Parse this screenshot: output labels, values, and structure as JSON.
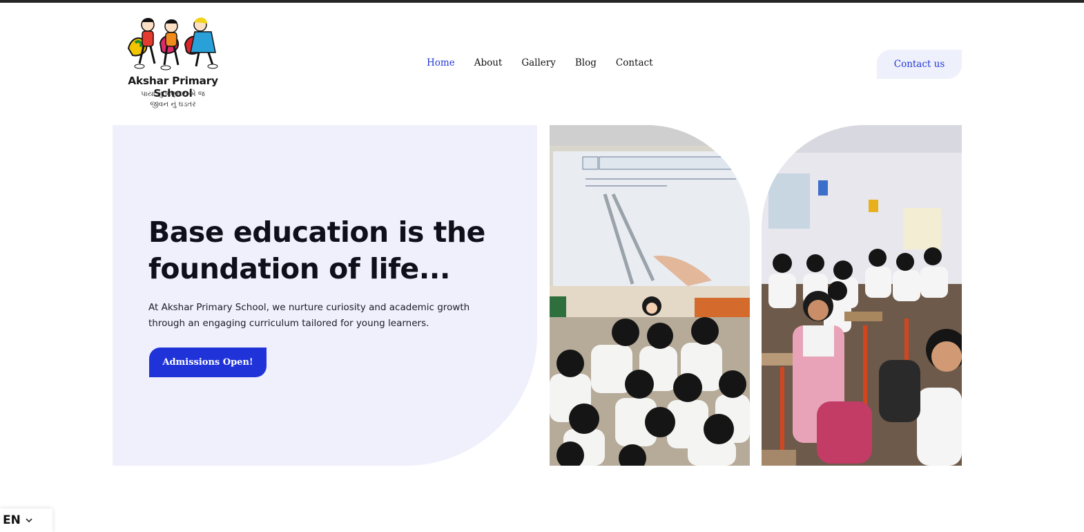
{
  "logo": {
    "name": "Akshar Primary School",
    "tagline_line1": "પાયા નું ભણતર એ જ",
    "tagline_line2": "જીવન નું ઘડતર"
  },
  "nav": {
    "items": [
      {
        "label": "Home",
        "active": true
      },
      {
        "label": "About",
        "active": false
      },
      {
        "label": "Gallery",
        "active": false
      },
      {
        "label": "Blog",
        "active": false
      },
      {
        "label": "Contact",
        "active": false
      }
    ]
  },
  "header": {
    "cta_label": "Contact us"
  },
  "hero": {
    "title_line1": "Base education is the",
    "title_line2": "foundation of life...",
    "description": "At Akshar Primary School, we nurture curiosity and academic growth through an engaging curriculum tailored for young learners.",
    "button_label": "Admissions Open!"
  },
  "language": {
    "code": "EN"
  },
  "colors": {
    "accent": "#1f33d9",
    "nav_active": "#2338d6",
    "panel_bg": "#eff0fb",
    "topbar": "#262626"
  },
  "icons": {
    "language_dropdown": "chevron-down-icon"
  }
}
